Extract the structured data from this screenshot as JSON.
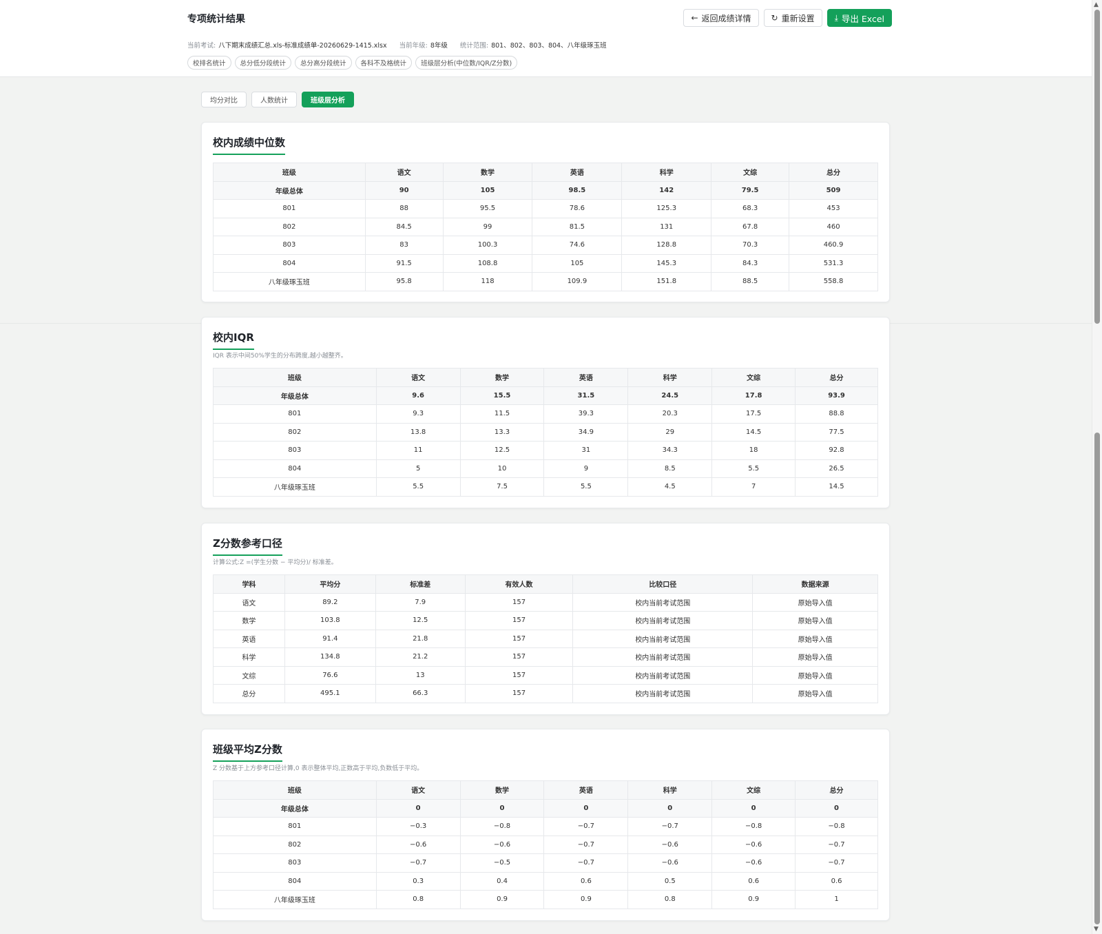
{
  "header": {
    "title": "专项统计结果",
    "back_label": "返回成绩详情",
    "reset_label": "重新设置",
    "export_label": "导出 Excel"
  },
  "meta": {
    "exam_label": "当前考试:",
    "exam_value": "八下期末成绩汇总.xls-标准成绩单-20260629-1415.xlsx",
    "grade_label": "当前年级:",
    "grade_value": "8年级",
    "range_label": "统计范围:",
    "range_value": "801、802、803、804、八年级琢玉班"
  },
  "tags": [
    "校排名统计",
    "总分低分段统计",
    "总分高分段统计",
    "各科不及格统计",
    "班级层分析(中位数/IQR/Z分数)"
  ],
  "subtabs": [
    "均分对比",
    "人数统计",
    "班级层分析"
  ],
  "active_subtab": 2,
  "median": {
    "title": "校内成绩中位数",
    "headers": [
      "班级",
      "语文",
      "数学",
      "英语",
      "科学",
      "文综",
      "总分"
    ],
    "rows": [
      [
        "年级总体",
        "90",
        "105",
        "98.5",
        "142",
        "79.5",
        "509"
      ],
      [
        "801",
        "88",
        "95.5",
        "78.6",
        "125.3",
        "68.3",
        "453"
      ],
      [
        "802",
        "84.5",
        "99",
        "81.5",
        "131",
        "67.8",
        "460"
      ],
      [
        "803",
        "83",
        "100.3",
        "74.6",
        "128.8",
        "70.3",
        "460.9"
      ],
      [
        "804",
        "91.5",
        "108.8",
        "105",
        "145.3",
        "84.3",
        "531.3"
      ],
      [
        "八年级琢玉班",
        "95.8",
        "118",
        "109.9",
        "151.8",
        "88.5",
        "558.8"
      ]
    ]
  },
  "iqr": {
    "title": "校内IQR",
    "subtitle": "IQR 表示中间50%学生的分布跨度,越小越整齐。",
    "headers": [
      "班级",
      "语文",
      "数学",
      "英语",
      "科学",
      "文综",
      "总分"
    ],
    "rows": [
      [
        "年级总体",
        "9.6",
        "15.5",
        "31.5",
        "24.5",
        "17.8",
        "93.9"
      ],
      [
        "801",
        "9.3",
        "11.5",
        "39.3",
        "20.3",
        "17.5",
        "88.8"
      ],
      [
        "802",
        "13.8",
        "13.3",
        "34.9",
        "29",
        "14.5",
        "77.5"
      ],
      [
        "803",
        "11",
        "12.5",
        "31",
        "34.3",
        "18",
        "92.8"
      ],
      [
        "804",
        "5",
        "10",
        "9",
        "8.5",
        "5.5",
        "26.5"
      ],
      [
        "八年级琢玉班",
        "5.5",
        "7.5",
        "5.5",
        "4.5",
        "7",
        "14.5"
      ]
    ]
  },
  "zref": {
    "title": "Z分数参考口径",
    "subtitle": "计算公式:Z =(学生分数 − 平均分)/ 标准差。",
    "headers": [
      "学科",
      "平均分",
      "标准差",
      "有效人数",
      "比较口径",
      "数据来源"
    ],
    "rows": [
      [
        "语文",
        "89.2",
        "7.9",
        "157",
        "校内当前考试范围",
        "原始导入值"
      ],
      [
        "数学",
        "103.8",
        "12.5",
        "157",
        "校内当前考试范围",
        "原始导入值"
      ],
      [
        "英语",
        "91.4",
        "21.8",
        "157",
        "校内当前考试范围",
        "原始导入值"
      ],
      [
        "科学",
        "134.8",
        "21.2",
        "157",
        "校内当前考试范围",
        "原始导入值"
      ],
      [
        "文综",
        "76.6",
        "13",
        "157",
        "校内当前考试范围",
        "原始导入值"
      ],
      [
        "总分",
        "495.1",
        "66.3",
        "157",
        "校内当前考试范围",
        "原始导入值"
      ]
    ]
  },
  "zclass": {
    "title": "班级平均Z分数",
    "subtitle": "Z 分数基于上方参考口径计算,0 表示整体平均,正数高于平均,负数低于平均。",
    "headers": [
      "班级",
      "语文",
      "数学",
      "英语",
      "科学",
      "文综",
      "总分"
    ],
    "rows": [
      [
        "年级总体",
        "0",
        "0",
        "0",
        "0",
        "0",
        "0"
      ],
      [
        "801",
        "−0.3",
        "−0.8",
        "−0.7",
        "−0.7",
        "−0.8",
        "−0.8"
      ],
      [
        "802",
        "−0.6",
        "−0.6",
        "−0.7",
        "−0.6",
        "−0.6",
        "−0.7"
      ],
      [
        "803",
        "−0.7",
        "−0.5",
        "−0.7",
        "−0.6",
        "−0.6",
        "−0.7"
      ],
      [
        "804",
        "0.3",
        "0.4",
        "0.6",
        "0.5",
        "0.6",
        "0.6"
      ],
      [
        "八年级琢玉班",
        "0.8",
        "0.9",
        "0.9",
        "0.8",
        "0.9",
        "1"
      ]
    ]
  },
  "icons": {
    "back": "arrow-left-icon",
    "reset": "refresh-icon",
    "export": "download-icon"
  },
  "colors": {
    "accent": "#14a05a"
  }
}
